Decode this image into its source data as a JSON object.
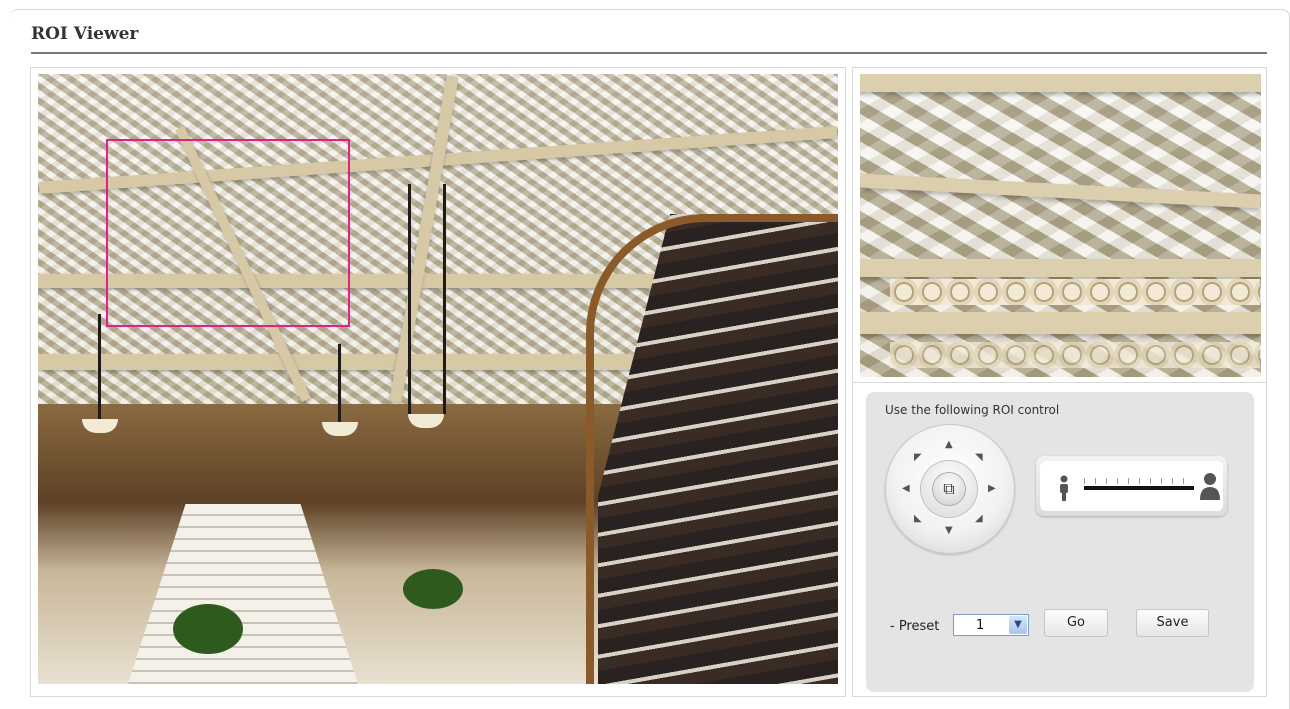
{
  "page": {
    "title": "ROI Viewer"
  },
  "main_view": {
    "image": "atrium-photo",
    "roi_outline_color": "#e0218a"
  },
  "zoom_view": {
    "image": "roi-zoom-preview"
  },
  "controls": {
    "label": "Use the following ROI control",
    "ptz": {
      "center_icon": "crop-icon",
      "center_glyph": "⧉",
      "arrows": {
        "up": "▲",
        "down": "▼",
        "left": "◀",
        "right": "▶",
        "up_left": "◤",
        "up_right": "◥",
        "down_left": "◣",
        "down_right": "◢"
      }
    },
    "zoom": {
      "out_icon": "person-small-icon",
      "in_icon": "person-large-icon",
      "out_glyph": "🯅",
      "in_glyph": "👤"
    },
    "preset": {
      "label": "- Preset",
      "value": "1",
      "arrow": "▼"
    },
    "go_label": "Go",
    "save_label": "Save"
  }
}
